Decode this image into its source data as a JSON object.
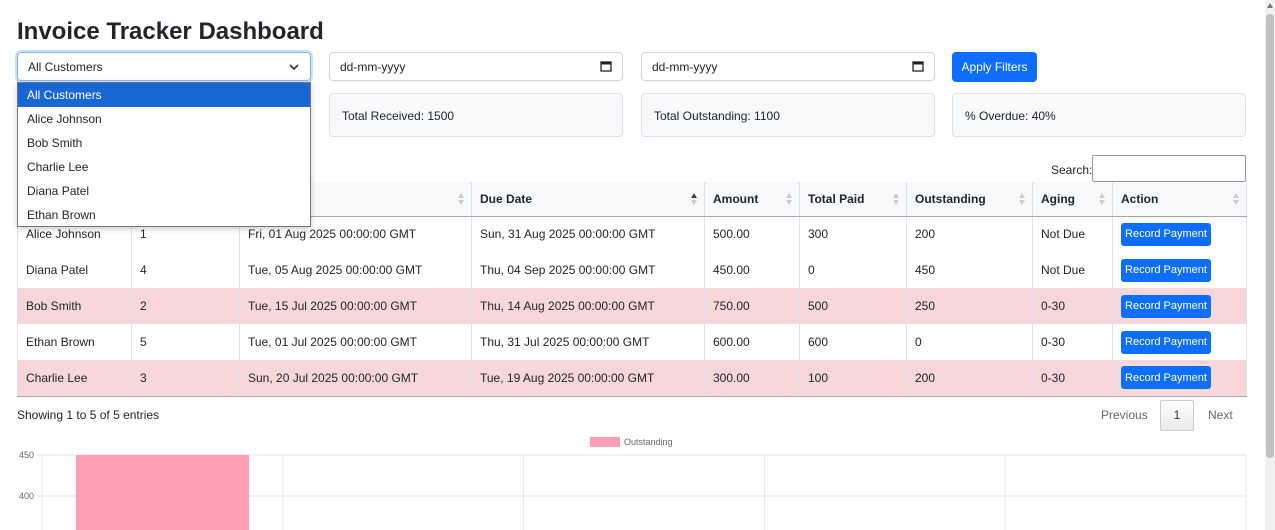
{
  "page": {
    "title": "Invoice Tracker Dashboard"
  },
  "filters": {
    "customer_selected": "All Customers",
    "customer_options": [
      "All Customers",
      "Alice Johnson",
      "Bob Smith",
      "Charlie Lee",
      "Diana Patel",
      "Ethan Brown"
    ],
    "start_date_placeholder": "dd-mm-yyyy",
    "end_date_placeholder": "dd-mm-yyyy",
    "apply_label": "Apply Filters"
  },
  "summary": {
    "total_received": "Total Received: 1500",
    "total_outstanding": "Total Outstanding: 1100",
    "pct_overdue": "% Overdue: 40%"
  },
  "table": {
    "search_label": "Search:",
    "columns": [
      "",
      "",
      "e",
      "Due Date",
      "Amount",
      "Total Paid",
      "Outstanding",
      "Aging",
      "Action"
    ],
    "rows": [
      {
        "customer": "Alice Johnson",
        "invoice": "1",
        "invoice_date": "Fri, 01 Aug 2025 00:00:00 GMT",
        "due_date": "Sun, 31 Aug 2025 00:00:00 GMT",
        "amount": "500.00",
        "paid": "300",
        "outstanding": "200",
        "aging": "Not Due",
        "overdue": false
      },
      {
        "customer": "Diana Patel",
        "invoice": "4",
        "invoice_date": "Tue, 05 Aug 2025 00:00:00 GMT",
        "due_date": "Thu, 04 Sep 2025 00:00:00 GMT",
        "amount": "450.00",
        "paid": "0",
        "outstanding": "450",
        "aging": "Not Due",
        "overdue": false
      },
      {
        "customer": "Bob Smith",
        "invoice": "2",
        "invoice_date": "Tue, 15 Jul 2025 00:00:00 GMT",
        "due_date": "Thu, 14 Aug 2025 00:00:00 GMT",
        "amount": "750.00",
        "paid": "500",
        "outstanding": "250",
        "aging": "0-30",
        "overdue": true
      },
      {
        "customer": "Ethan Brown",
        "invoice": "5",
        "invoice_date": "Tue, 01 Jul 2025 00:00:00 GMT",
        "due_date": "Thu, 31 Jul 2025 00:00:00 GMT",
        "amount": "600.00",
        "paid": "600",
        "outstanding": "0",
        "aging": "0-30",
        "overdue": false
      },
      {
        "customer": "Charlie Lee",
        "invoice": "3",
        "invoice_date": "Sun, 20 Jul 2025 00:00:00 GMT",
        "due_date": "Tue, 19 Aug 2025 00:00:00 GMT",
        "amount": "300.00",
        "paid": "100",
        "outstanding": "200",
        "aging": "0-30",
        "overdue": true
      }
    ],
    "action_label": "Record Payment",
    "info": "Showing 1 to 5 of 5 entries",
    "pagination": {
      "previous": "Previous",
      "page": "1",
      "next": "Next"
    }
  },
  "chart_data": {
    "type": "bar",
    "series": [
      {
        "name": "Outstanding",
        "values": [
          450
        ]
      }
    ],
    "yticks": [
      450,
      400
    ],
    "ylim": [
      350,
      450
    ],
    "grid": true,
    "legend": "top-center",
    "color": "#ff9fb3"
  },
  "colors": {
    "primary": "#0d6efd",
    "overdue_row": "#f8d7da",
    "select_highlight": "#1967d2"
  }
}
